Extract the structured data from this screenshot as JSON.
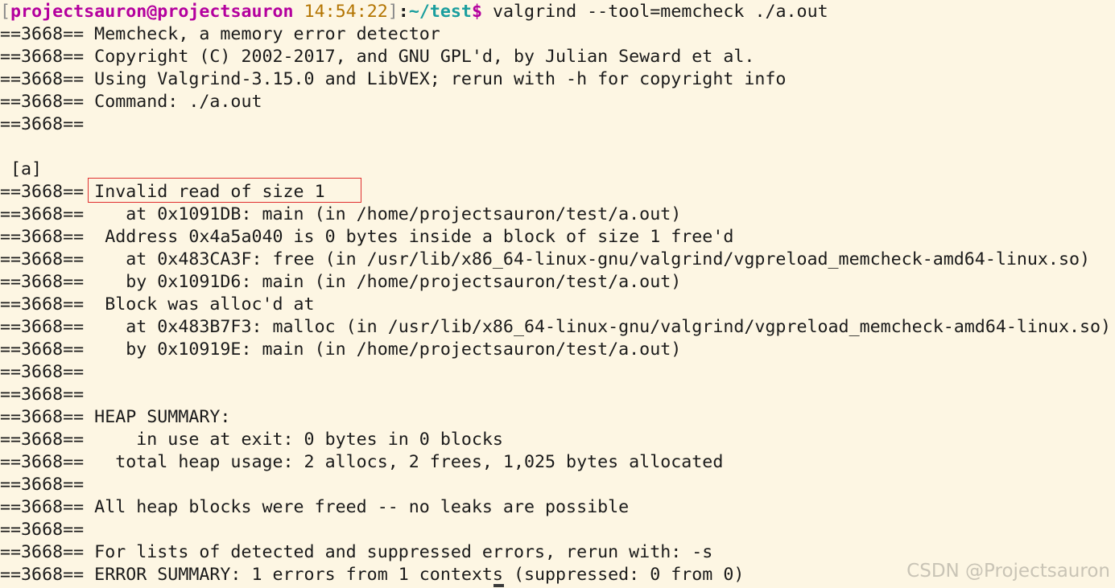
{
  "prompt": {
    "open_bracket": "[",
    "user_host": "projectsauron@projectsauron",
    "time": "14:54:22",
    "close_bracket": "]",
    "colon": ":",
    "path": "~/test",
    "dollar": "$",
    "command": " valgrind --tool=memcheck ./a.out"
  },
  "lines": [
    "==3668== Memcheck, a memory error detector",
    "==3668== Copyright (C) 2002-2017, and GNU GPL'd, by Julian Seward et al.",
    "==3668== Using Valgrind-3.15.0 and LibVEX; rerun with -h for copyright info",
    "==3668== Command: ./a.out",
    "==3668==",
    "",
    " [a]",
    "==3668== Invalid read of size 1",
    "==3668==    at 0x1091DB: main (in /home/projectsauron/test/a.out)",
    "==3668==  Address 0x4a5a040 is 0 bytes inside a block of size 1 free'd",
    "==3668==    at 0x483CA3F: free (in /usr/lib/x86_64-linux-gnu/valgrind/vgpreload_memcheck-amd64-linux.so)",
    "==3668==    by 0x1091D6: main (in /home/projectsauron/test/a.out)",
    "==3668==  Block was alloc'd at",
    "==3668==    at 0x483B7F3: malloc (in /usr/lib/x86_64-linux-gnu/valgrind/vgpreload_memcheck-amd64-linux.so)",
    "==3668==    by 0x10919E: main (in /home/projectsauron/test/a.out)",
    "==3668==",
    "==3668==",
    "==3668== HEAP SUMMARY:",
    "==3668==     in use at exit: 0 bytes in 0 blocks",
    "==3668==   total heap usage: 2 allocs, 2 frees, 1,025 bytes allocated",
    "==3668==",
    "==3668== All heap blocks were freed -- no leaks are possible",
    "==3668==",
    "==3668== For lists of detected and suppressed errors, rerun with: -s",
    "==3668== ERROR SUMMARY: 1 errors from 1 contexts (suppressed: 0 from 0)"
  ],
  "watermark": "CSDN @Projectsauron",
  "colors": {
    "background": "#fdf6e3",
    "text": "#1a1a1a",
    "user_host": "#b4009e",
    "time": "#b37400",
    "path": "#1a9e9e",
    "highlight_border": "#e03030"
  }
}
